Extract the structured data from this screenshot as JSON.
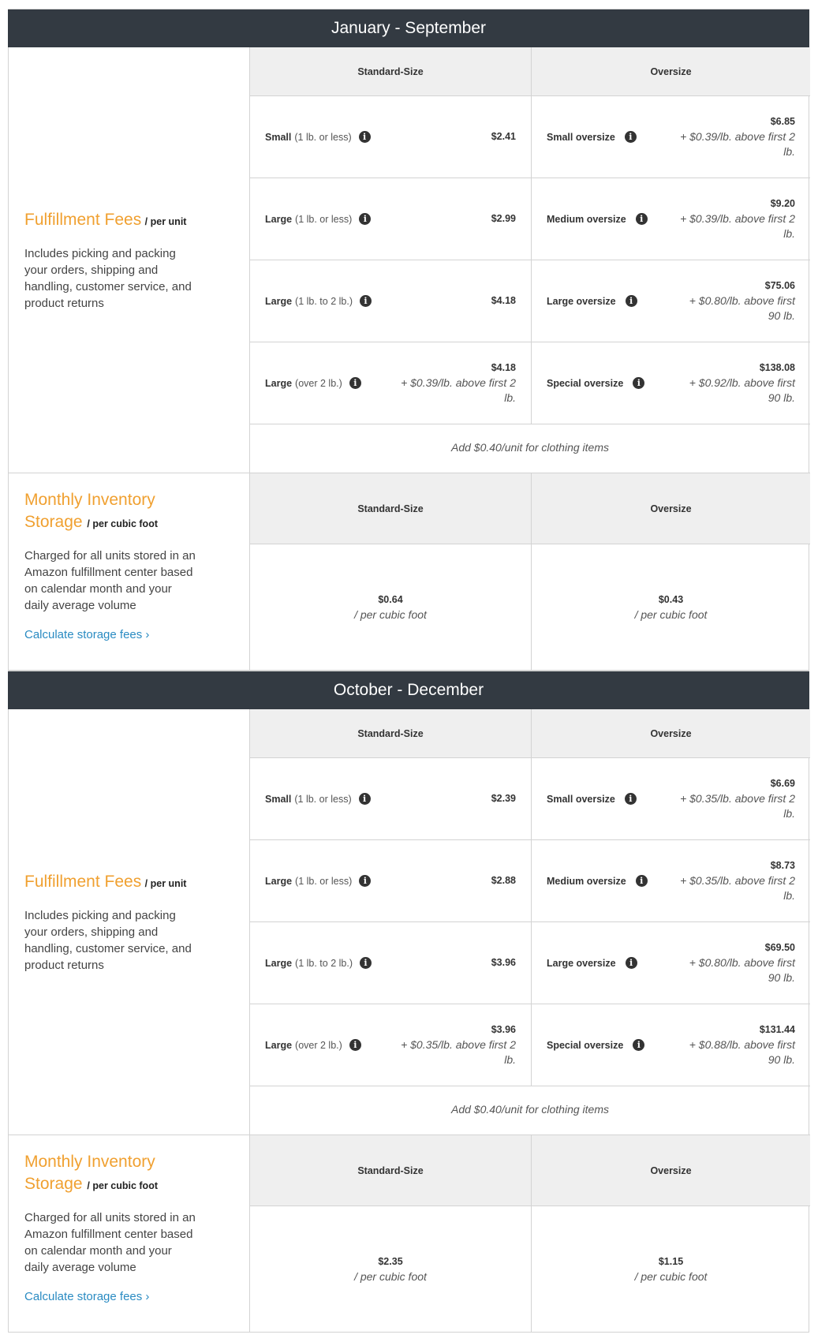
{
  "colors": {
    "header_bg": "#333a42",
    "accent_orange": "#f0a030",
    "link_blue": "#2a8bc2",
    "subheader_bg": "#efefef"
  },
  "sections": [
    {
      "period": "January - September",
      "fulfillment": {
        "title": "Fulfillment Fees",
        "unit": "/ per unit",
        "description": "Includes picking and packing your orders, shipping and handling, customer service, and product returns",
        "col_standard": "Standard-Size",
        "col_oversize": "Oversize",
        "rows": [
          {
            "std_name": "Small",
            "std_qual": "(1 lb. or less)",
            "std_price": "$2.41",
            "std_extra": "",
            "over_name": "Small oversize",
            "over_price": "$6.85",
            "over_extra": "+ $0.39/lb. above first 2 lb."
          },
          {
            "std_name": "Large",
            "std_qual": "(1 lb. or less)",
            "std_price": "$2.99",
            "std_extra": "",
            "over_name": "Medium oversize",
            "over_price": "$9.20",
            "over_extra": "+ $0.39/lb. above first 2 lb."
          },
          {
            "std_name": "Large",
            "std_qual": "(1 lb. to 2 lb.)",
            "std_price": "$4.18",
            "std_extra": "",
            "over_name": "Large oversize",
            "over_price": "$75.06",
            "over_extra": "+ $0.80/lb. above first 90 lb."
          },
          {
            "std_name": "Large",
            "std_qual": "(over 2 lb.)",
            "std_price": "$4.18",
            "std_extra": "+ $0.39/lb. above first 2 lb.",
            "over_name": "Special oversize",
            "over_price": "$138.08",
            "over_extra": "+ $0.92/lb. above first 90 lb."
          }
        ],
        "clothing_note": "Add $0.40/unit for clothing items"
      },
      "storage": {
        "title": "Monthly Inventory Storage",
        "unit": "/ per cubic foot",
        "description": "Charged for all units stored in an Amazon fulfillment center based on calendar month and your daily average volume",
        "link": "Calculate storage fees ›",
        "col_standard": "Standard-Size",
        "col_oversize": "Oversize",
        "std_price": "$0.64",
        "std_unit": "/ per cubic foot",
        "over_price": "$0.43",
        "over_unit": "/ per cubic foot"
      }
    },
    {
      "period": "October - December",
      "fulfillment": {
        "title": "Fulfillment Fees",
        "unit": "/ per unit",
        "description": "Includes picking and packing your orders, shipping and handling, customer service, and product returns",
        "col_standard": "Standard-Size",
        "col_oversize": "Oversize",
        "rows": [
          {
            "std_name": "Small",
            "std_qual": "(1 lb. or less)",
            "std_price": "$2.39",
            "std_extra": "",
            "over_name": "Small oversize",
            "over_price": "$6.69",
            "over_extra": "+ $0.35/lb. above first 2 lb."
          },
          {
            "std_name": "Large",
            "std_qual": "(1 lb. or less)",
            "std_price": "$2.88",
            "std_extra": "",
            "over_name": "Medium oversize",
            "over_price": "$8.73",
            "over_extra": "+ $0.35/lb. above first 2 lb."
          },
          {
            "std_name": "Large",
            "std_qual": "(1 lb. to 2 lb.)",
            "std_price": "$3.96",
            "std_extra": "",
            "over_name": "Large oversize",
            "over_price": "$69.50",
            "over_extra": "+ $0.80/lb. above first 90 lb."
          },
          {
            "std_name": "Large",
            "std_qual": "(over 2 lb.)",
            "std_price": "$3.96",
            "std_extra": "+ $0.35/lb. above first 2 lb.",
            "over_name": "Special oversize",
            "over_price": "$131.44",
            "over_extra": "+ $0.88/lb. above first 90 lb."
          }
        ],
        "clothing_note": "Add $0.40/unit for clothing items"
      },
      "storage": {
        "title": "Monthly Inventory Storage",
        "unit": "/ per cubic foot",
        "description": "Charged for all units stored in an Amazon fulfillment center based on calendar month and your daily average volume",
        "link": "Calculate storage fees ›",
        "col_standard": "Standard-Size",
        "col_oversize": "Oversize",
        "std_price": "$2.35",
        "std_unit": "/ per cubic foot",
        "over_price": "$1.15",
        "over_unit": "/ per cubic foot"
      }
    }
  ],
  "icons": {
    "info": "info-icon"
  }
}
